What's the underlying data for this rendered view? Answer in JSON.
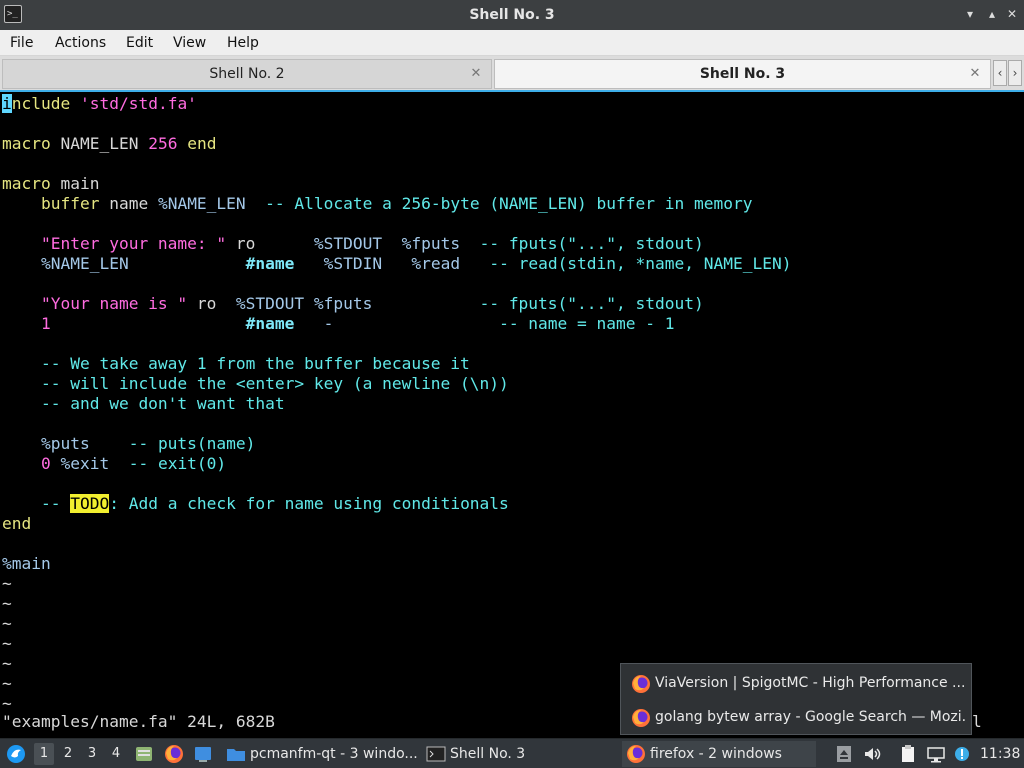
{
  "window": {
    "title": "Shell No. 3",
    "controls": [
      "minimize",
      "maximize",
      "close"
    ]
  },
  "menubar": {
    "items": [
      "File",
      "Actions",
      "Edit",
      "View",
      "Help"
    ]
  },
  "tabs": [
    {
      "label": "Shell No. 2",
      "active": false
    },
    {
      "label": "Shell No. 3",
      "active": true
    }
  ],
  "terminal": {
    "lines": [
      [
        {
          "t": "i",
          "c": "cursor"
        },
        {
          "t": "nclude",
          "c": "kw"
        },
        {
          "t": " ",
          "c": "norm"
        },
        {
          "t": "'std/std.fa'",
          "c": "str"
        }
      ],
      [],
      [
        {
          "t": "macro",
          "c": "kw"
        },
        {
          "t": " NAME_LEN ",
          "c": "norm"
        },
        {
          "t": "256",
          "c": "num"
        },
        {
          "t": " ",
          "c": "norm"
        },
        {
          "t": "end",
          "c": "kw"
        }
      ],
      [],
      [
        {
          "t": "macro",
          "c": "kw"
        },
        {
          "t": " main",
          "c": "norm"
        }
      ],
      [
        {
          "t": "    ",
          "c": "norm"
        },
        {
          "t": "buffer",
          "c": "kw"
        },
        {
          "t": " name ",
          "c": "norm"
        },
        {
          "t": "%NAME_LEN",
          "c": "macro"
        },
        {
          "t": "  -- Allocate a 256-byte (NAME_LEN) buffer in memory",
          "c": "com"
        }
      ],
      [],
      [
        {
          "t": "    ",
          "c": "norm"
        },
        {
          "t": "\"Enter your name: \"",
          "c": "str"
        },
        {
          "t": " ro      ",
          "c": "norm"
        },
        {
          "t": "%STDOUT",
          "c": "macro"
        },
        {
          "t": "  ",
          "c": "norm"
        },
        {
          "t": "%fputs",
          "c": "macro"
        },
        {
          "t": "  -- fputs(\"...\", stdout)",
          "c": "com"
        }
      ],
      [
        {
          "t": "    ",
          "c": "norm"
        },
        {
          "t": "%NAME_LEN",
          "c": "macro"
        },
        {
          "t": "            ",
          "c": "norm"
        },
        {
          "t": "#name",
          "c": "bold"
        },
        {
          "t": "   ",
          "c": "norm"
        },
        {
          "t": "%STDIN",
          "c": "macro"
        },
        {
          "t": "   ",
          "c": "norm"
        },
        {
          "t": "%read",
          "c": "macro"
        },
        {
          "t": "   -- read(stdin, *name, NAME_LEN)",
          "c": "com"
        }
      ],
      [],
      [
        {
          "t": "    ",
          "c": "norm"
        },
        {
          "t": "\"Your name is \"",
          "c": "str"
        },
        {
          "t": " ro  ",
          "c": "norm"
        },
        {
          "t": "%STDOUT",
          "c": "macro"
        },
        {
          "t": " ",
          "c": "norm"
        },
        {
          "t": "%fputs",
          "c": "macro"
        },
        {
          "t": "           -- fputs(\"...\", stdout)",
          "c": "com"
        }
      ],
      [
        {
          "t": "    ",
          "c": "norm"
        },
        {
          "t": "1",
          "c": "num"
        },
        {
          "t": "                    ",
          "c": "norm"
        },
        {
          "t": "#name",
          "c": "bold"
        },
        {
          "t": "   ",
          "c": "norm"
        },
        {
          "t": "-",
          "c": "macro"
        },
        {
          "t": "                 -- name = name - 1",
          "c": "com"
        }
      ],
      [],
      [
        {
          "t": "    -- We take away 1 from the buffer because it",
          "c": "com"
        }
      ],
      [
        {
          "t": "    -- will include the <enter> key (a newline (\\n))",
          "c": "com"
        }
      ],
      [
        {
          "t": "    -- and we don't want that",
          "c": "com"
        }
      ],
      [],
      [
        {
          "t": "    ",
          "c": "norm"
        },
        {
          "t": "%puts",
          "c": "macro"
        },
        {
          "t": "    -- puts(name)",
          "c": "com"
        }
      ],
      [
        {
          "t": "    ",
          "c": "norm"
        },
        {
          "t": "0",
          "c": "num"
        },
        {
          "t": " ",
          "c": "norm"
        },
        {
          "t": "%exit",
          "c": "macro"
        },
        {
          "t": "  -- exit(0)",
          "c": "com"
        }
      ],
      [],
      [
        {
          "t": "    -- ",
          "c": "com"
        },
        {
          "t": "TODO",
          "c": "todo"
        },
        {
          "t": ": Add a check for name using conditionals",
          "c": "com"
        }
      ],
      [
        {
          "t": "end",
          "c": "kw"
        }
      ],
      [],
      [
        {
          "t": "%main",
          "c": "macro"
        }
      ],
      [
        {
          "t": "~",
          "c": "tilde"
        }
      ],
      [
        {
          "t": "~",
          "c": "tilde"
        }
      ],
      [
        {
          "t": "~",
          "c": "tilde"
        }
      ],
      [
        {
          "t": "~",
          "c": "tilde"
        }
      ],
      [
        {
          "t": "~",
          "c": "tilde"
        }
      ],
      [
        {
          "t": "~",
          "c": "tilde"
        }
      ],
      [
        {
          "t": "~",
          "c": "tilde"
        }
      ]
    ],
    "status_line": "\"examples/name.fa\" 24L, 682B",
    "status_tail": "l"
  },
  "popup": {
    "items": [
      {
        "label": "ViaVersion | SpigotMC - High Performance ...",
        "icon": "firefox-icon"
      },
      {
        "label": "golang bytew array - Google Search — Mozi...",
        "icon": "firefox-icon"
      }
    ]
  },
  "panel": {
    "desktops": [
      "1",
      "2",
      "3",
      "4"
    ],
    "tasks": [
      {
        "label": "pcmanfm-qt - 3 windo...",
        "icon": "folder-icon"
      },
      {
        "label": "Shell No. 3",
        "icon": "terminal-icon"
      },
      {
        "label": "firefox - 2 windows",
        "icon": "firefox-icon"
      }
    ],
    "clock": "11:38"
  },
  "colors": {
    "accent": "#3daee9",
    "keyword": "#e5e581",
    "string": "#ff6ce0",
    "comment": "#60e8e8",
    "todo_bg": "#f2ef2f"
  }
}
